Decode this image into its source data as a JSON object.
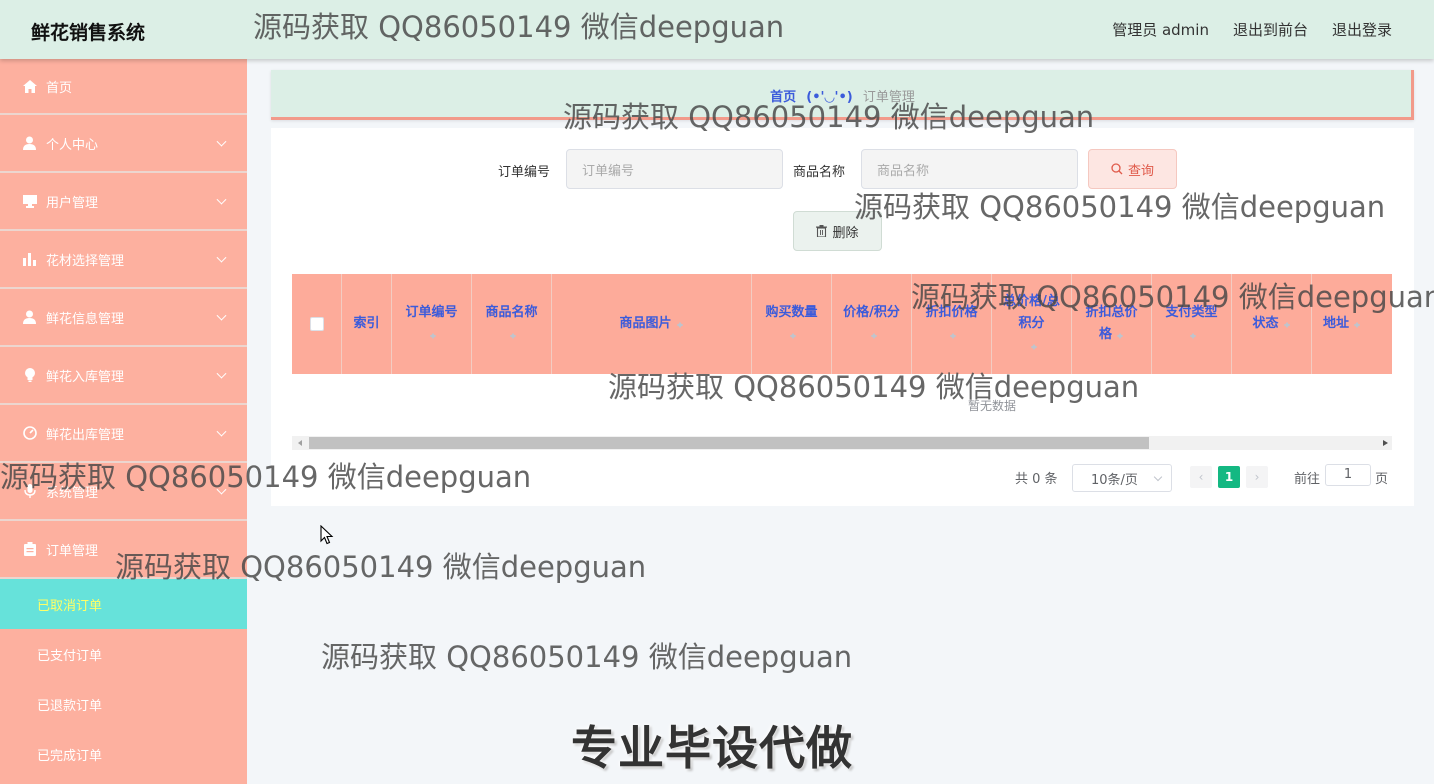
{
  "header": {
    "brand": "鲜花销售系统",
    "admin_label": "管理员 admin",
    "front_label": "退出到前台",
    "logout_label": "退出登录"
  },
  "sidebar": {
    "items": [
      {
        "label": "首页",
        "icon": "home-icon"
      },
      {
        "label": "个人中心",
        "icon": "user-icon"
      },
      {
        "label": "用户管理",
        "icon": "monitor-icon"
      },
      {
        "label": "花材选择管理",
        "icon": "bar-chart-icon"
      },
      {
        "label": "鲜花信息管理",
        "icon": "user-icon"
      },
      {
        "label": "鲜花入库管理",
        "icon": "bulb-icon"
      },
      {
        "label": "鲜花出库管理",
        "icon": "gauge-icon"
      },
      {
        "label": "系统管理",
        "icon": "mic-icon"
      },
      {
        "label": "订单管理",
        "icon": "clipboard-icon"
      }
    ],
    "sub_items": [
      {
        "label": "已取消订单",
        "active": true
      },
      {
        "label": "已支付订单"
      },
      {
        "label": "已退款订单"
      },
      {
        "label": "已完成订单"
      }
    ]
  },
  "breadcrumb": {
    "home": "首页",
    "separator": "(•'◡'•)",
    "current": "订单管理"
  },
  "search": {
    "order_no_label": "订单编号",
    "order_no_placeholder": "订单编号",
    "product_label": "商品名称",
    "product_placeholder": "商品名称",
    "query_label": "查询",
    "delete_label": "删除"
  },
  "table": {
    "columns": [
      "索引",
      "订单编号",
      "商品名称",
      "商品图片",
      "购买数量",
      "价格/积分",
      "折扣价格",
      "总价格/总积分",
      "折扣总价格",
      "支付类型",
      "状态",
      "地址"
    ],
    "empty_text": "暂无数据"
  },
  "pagination": {
    "total": "共 0 条",
    "page_size": "10条/页",
    "current_page": "1",
    "goto_label": "前往",
    "goto_value": "1",
    "page_suffix": "页"
  },
  "overlay": {
    "watermark": "源码获取 QQ86050149 微信deepguan",
    "promo": "专业毕设代做"
  }
}
